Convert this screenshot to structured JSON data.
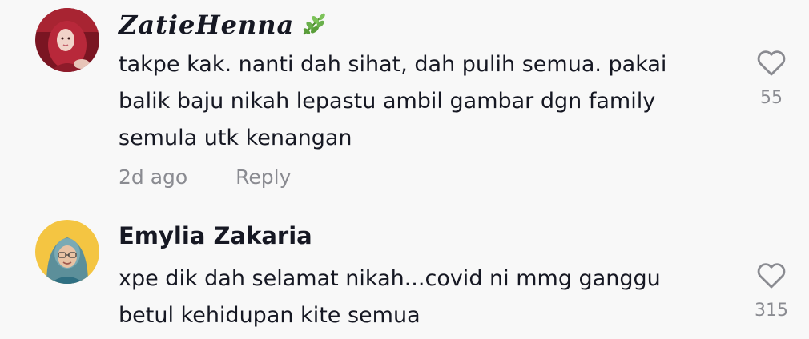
{
  "comments": [
    {
      "username": "ZatieHenna",
      "username_emoji": "herb",
      "text": "takpe kak. nanti dah sihat, dah pulih semua. pakai balik baju nikah lepastu ambil gambar dgn family semula utk kenangan",
      "time": "2d ago",
      "reply_label": "Reply",
      "likes": "55",
      "avatar_color": "#9b1c2c"
    },
    {
      "username": "Emylia Zakaria",
      "text": "xpe dik dah selamat nikah...covid ni mmg ganggu betul kehidupan kite semua",
      "likes": "315",
      "avatar_color": "#f4c542"
    }
  ],
  "icons": {
    "like": "heart-outline-icon",
    "emoji": "herb-icon"
  },
  "colors": {
    "text": "#161823",
    "muted": "#8a8b91",
    "background": "#f8f8f8"
  }
}
